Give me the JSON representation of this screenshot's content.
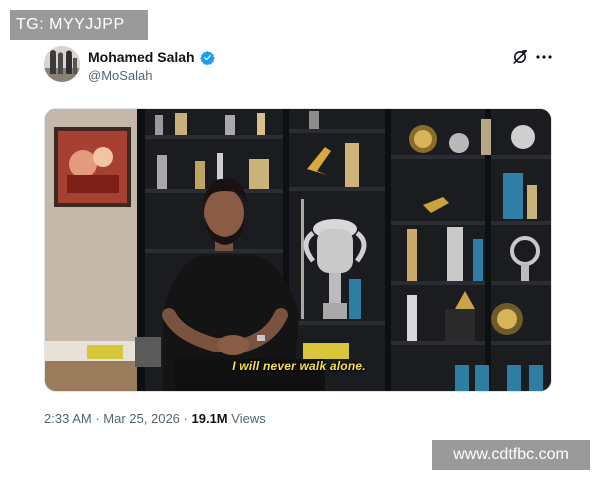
{
  "watermarks": {
    "top_left": "TG: MYYJJPP",
    "bottom_right": "www.cdtfbc.com"
  },
  "tweet": {
    "author": {
      "display_name": "Mohamed Salah",
      "handle": "@MoSalah",
      "verified": true,
      "verified_icon": "verified-badge-icon",
      "verified_color": "#1d9bf0"
    },
    "actions": {
      "grok_icon": "grok-icon",
      "more_icon": "more-options-icon"
    },
    "media": {
      "caption": "I will never walk alone."
    },
    "meta": {
      "time": "2:33 AM",
      "separator": "·",
      "date": "Mar 25, 2026",
      "views_count": "19.1M",
      "views_label": "Views"
    }
  },
  "colors": {
    "text_primary": "#0f1419",
    "text_secondary": "#536471",
    "caption_yellow": "#f3e24a",
    "watermark_bg": "#9a9a9a"
  }
}
